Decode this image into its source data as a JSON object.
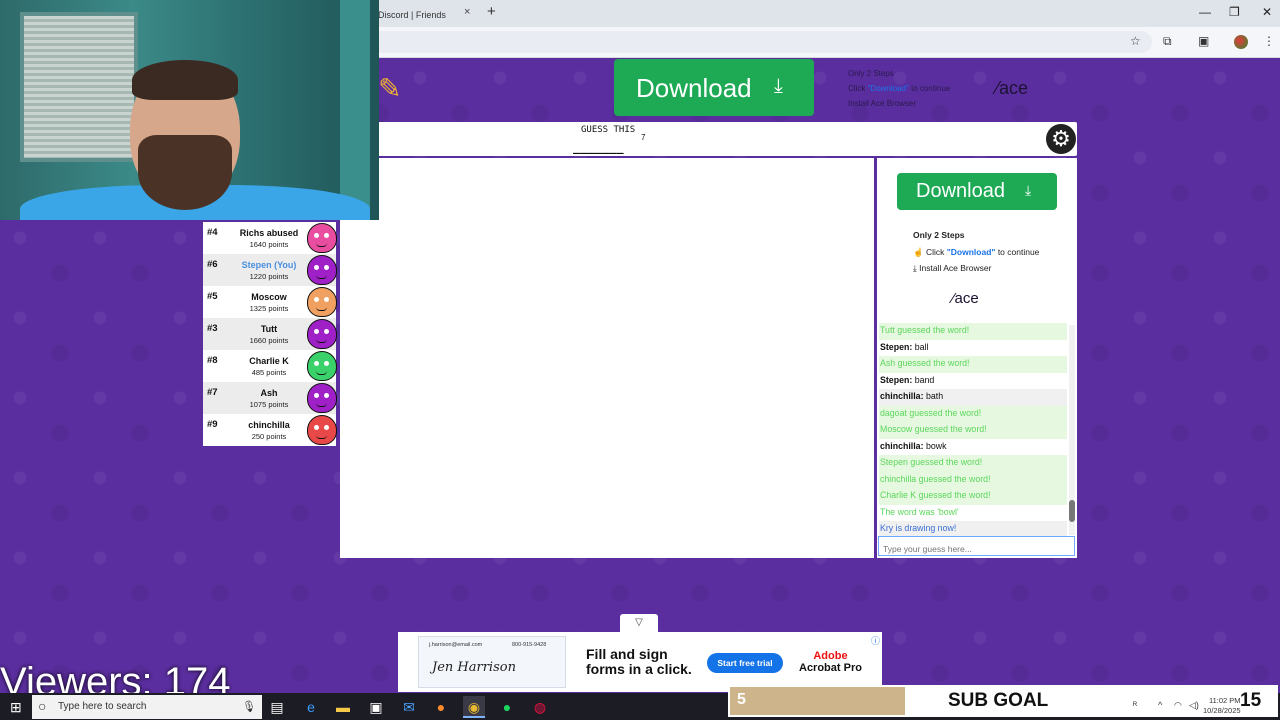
{
  "browser": {
    "tab_title": "Discord | Friends",
    "tab_close": "×",
    "new_tab": "+",
    "window_controls": [
      "—",
      "❐",
      "✕"
    ]
  },
  "top_ad": {
    "download_label": "Download",
    "steps_title": "Only 2 Steps",
    "step1_prefix": "Click",
    "step1_highlight": "\"Download\"",
    "step1_suffix": "to continue",
    "step2": "Install Ace Browser",
    "brand": "ace"
  },
  "game": {
    "guess_label": "GUESS THIS",
    "blanks": "_______",
    "letter_count": "7"
  },
  "right_ad": {
    "download_label": "Download",
    "steps_title": "Only 2 Steps",
    "step1_prefix": "Click",
    "step1_highlight": "\"Download\"",
    "step1_suffix": "to continue",
    "step2": "Install Ace Browser",
    "brand": "ace"
  },
  "chat": {
    "messages": [
      {
        "who": "",
        "text": "Tutt guessed the word!",
        "style": "green greenbg"
      },
      {
        "who": "Stepen:",
        "text": " ball",
        "style": ""
      },
      {
        "who": "",
        "text": "Ash guessed the word!",
        "style": "green greenbg"
      },
      {
        "who": "Stepen:",
        "text": " band",
        "style": ""
      },
      {
        "who": "chinchilla:",
        "text": " bath",
        "style": "greybg"
      },
      {
        "who": "",
        "text": "dagoat guessed the word!",
        "style": "green greenbg"
      },
      {
        "who": "",
        "text": "Moscow guessed the word!",
        "style": "green greenbg"
      },
      {
        "who": "chinchilla:",
        "text": " bowk",
        "style": ""
      },
      {
        "who": "",
        "text": "Stepen guessed the word!",
        "style": "green greenbg"
      },
      {
        "who": "",
        "text": "chinchilla guessed the word!",
        "style": "green greenbg"
      },
      {
        "who": "",
        "text": "Charlie K guessed the word!",
        "style": "green greenbg"
      },
      {
        "who": "",
        "text": "The word was 'bowl'",
        "style": "green"
      },
      {
        "who": "",
        "text": "Kry is drawing now!",
        "style": "blue greybg"
      }
    ],
    "input_placeholder": "Type your guess here..."
  },
  "players": [
    {
      "rank": "#4",
      "name": "Richs abused",
      "points": "1640 points",
      "color": "#e94da0",
      "you": false
    },
    {
      "rank": "#6",
      "name": "Stepen (You)",
      "points": "1220 points",
      "color": "#a020c8",
      "you": true
    },
    {
      "rank": "#5",
      "name": "Moscow",
      "points": "1325 points",
      "color": "#f0a060",
      "you": false
    },
    {
      "rank": "#3",
      "name": "Tutt",
      "points": "1660 points",
      "color": "#a020c8",
      "you": false
    },
    {
      "rank": "#8",
      "name": "Charlie K",
      "points": "485 points",
      "color": "#3ad16a",
      "you": false
    },
    {
      "rank": "#7",
      "name": "Ash",
      "points": "1075 points",
      "color": "#a020c8",
      "you": false
    },
    {
      "rank": "#9",
      "name": "chinchilla",
      "points": "250 points",
      "color": "#e84848",
      "you": false
    }
  ],
  "stream": {
    "viewers": "Viewers: 174",
    "subgoal_current": "5",
    "subgoal_label": "SUB GOAL",
    "subgoal_target": "15"
  },
  "bottom_ad": {
    "email": "j.harrison@email.com",
    "phone": "800-915-9428",
    "signature": "Jen Harrison",
    "headline1": "Fill and sign",
    "headline2": "forms in a click.",
    "cta": "Start free trial",
    "brand1": "Adobe",
    "brand2": "Acrobat Pro"
  },
  "taskbar": {
    "search_placeholder": "Type here to search",
    "time": "11:02 PM",
    "date": "10/28/2025"
  }
}
